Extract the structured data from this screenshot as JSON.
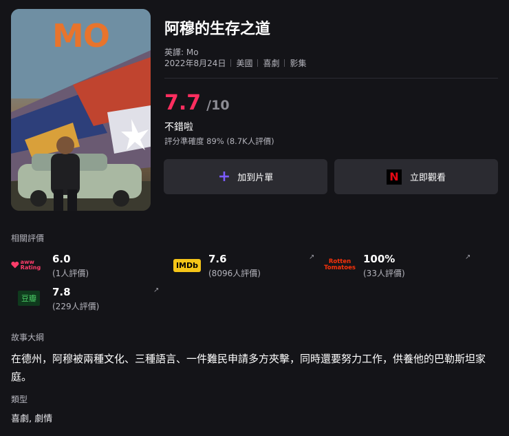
{
  "poster": {
    "title_text": "MO"
  },
  "title": "阿穆的生存之道",
  "english_title": "英譯: Mo",
  "meta": [
    "2022年8月24日",
    "美國",
    "喜劇",
    "影集"
  ],
  "score": {
    "value": "7.7",
    "out_of": "/10",
    "verdict": "不錯啦",
    "accuracy": "評分準確度 89% (8.7K人評價)"
  },
  "buttons": {
    "add_label": "加到片單",
    "watch_label": "立即觀看"
  },
  "related": {
    "label": "相關評價",
    "items": [
      {
        "source": "aww Rating",
        "logo_text": "aww Rating",
        "value": "6.0",
        "count": "(1人評價)"
      },
      {
        "source": "IMDb",
        "logo_text": "IMDb",
        "value": "7.6",
        "count": "(8096人評價)"
      },
      {
        "source": "Rotten Tomatoes",
        "logo_text": "Rotten Tomatoes",
        "value": "100%",
        "count": "(33人評價)"
      },
      {
        "source": "豆瓣",
        "logo_text": "豆瓣",
        "value": "7.8",
        "count": "(229人評價)"
      }
    ]
  },
  "synopsis": {
    "label": "故事大綱",
    "text": "在德州，阿穆被兩種文化、三種語言、一件難民申請多方夾擊，同時還要努力工作，供養他的巴勒斯坦家庭。"
  },
  "genre": {
    "label": "類型",
    "text": "喜劇, 劇情"
  },
  "colors": {
    "accent_score": "#ff2e5f",
    "plus": "#7c5cff",
    "netflix": "#e50914",
    "imdb": "#f5c518",
    "rotten": "#fa320a"
  },
  "icons": {
    "add": "plus-icon",
    "watch": "netflix-icon",
    "external": "external-link-icon"
  }
}
